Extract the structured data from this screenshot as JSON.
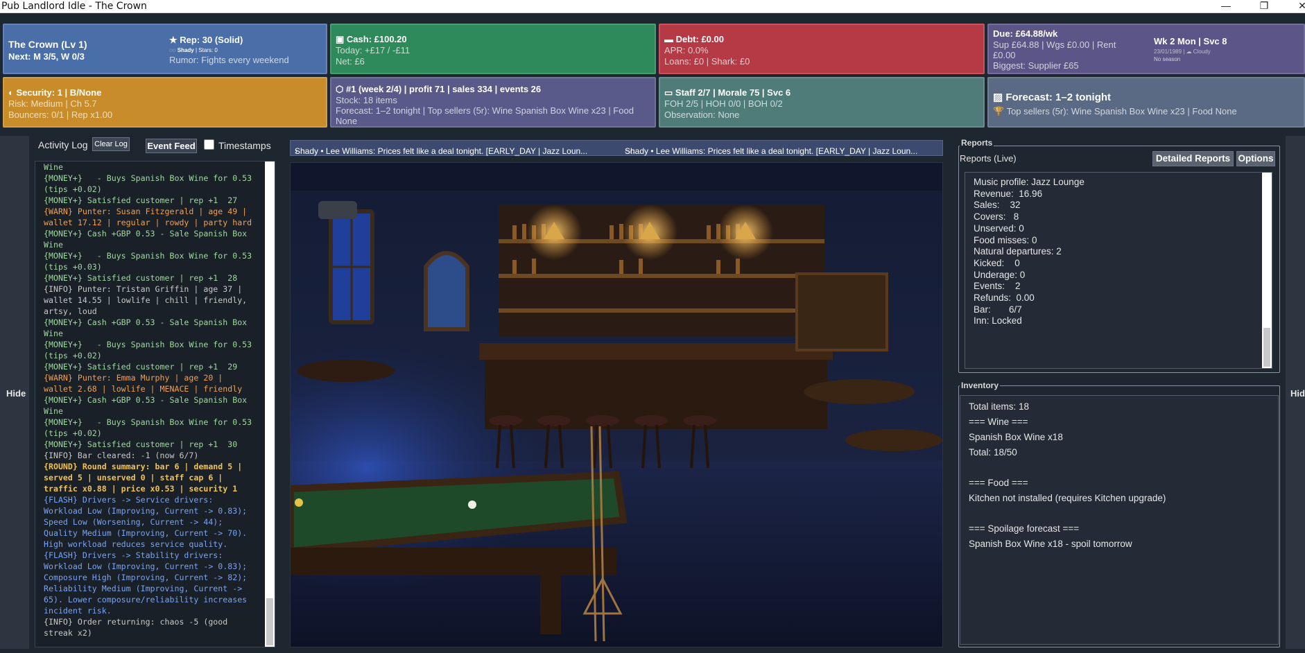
{
  "window": {
    "title": "Pub Landlord Idle - The Crown",
    "controls": {
      "minimize": "—",
      "maximize": "❐",
      "close": "✕"
    }
  },
  "panels": {
    "pub": {
      "name": "The Crown (Lv 1)",
      "next": "Next: M 3/5, W 0/3",
      "rep": "Rep: 30 (Solid)",
      "rep_sub_bold": "Shady",
      "rep_sub": " | Stars: 0",
      "rumor": "Rumor: Fights every weekend"
    },
    "cash": {
      "title": "Cash: £100.20",
      "today": "Today: +£17 / -£11",
      "net": "Net: £6"
    },
    "debt": {
      "title": "Debt: £0.00",
      "apr": "APR: 0.0%",
      "loans": "Loans: £0 | Shark: £0"
    },
    "due": {
      "title": "Due: £64.88/wk",
      "breakdown_1": "Sup £64.88 | Wgs £0.00 | Rent",
      "breakdown_2": "£0.00",
      "biggest": "Biggest: Supplier £65",
      "week": "Wk 2 Mon | Svc 8",
      "date_weather": "23/01/1989 | ☁ Cloudy",
      "season": "No season"
    },
    "security": {
      "title": "Security: 1 | B/None",
      "risk": "Risk: Medium | Ch 5.7",
      "bouncers": "Bouncers: 0/1 | Rep x1.00"
    },
    "ranking": {
      "title": "#1 (week 2/4) | profit 71 | sales 334 | events 26",
      "stock": "Stock: 18 items",
      "forecast_1": "Forecast: 1–2 tonight | Top sellers (5r): Wine Spanish Box Wine x23 | Food",
      "forecast_2": "None"
    },
    "staff": {
      "title": "Staff 2/7 | Morale 75 | Svc 6",
      "roles": "FOH 2/5 | HOH 0/0 | BOH 0/2",
      "observation": "Observation: None"
    },
    "forecast": {
      "title": "Forecast: 1–2 tonight",
      "top": "Top sellers (5r): Wine Spanish Box Wine x23 | Food None"
    }
  },
  "sides": {
    "left_hide": "Hide",
    "right_hide": "Hid"
  },
  "activity": {
    "label": "Activity Log",
    "clear": "Clear Log",
    "event_feed": "Event Feed",
    "timestamps": "Timestamps",
    "lines": [
      {
        "cls": "c-money",
        "text": "Wine"
      },
      {
        "cls": "c-money",
        "text": "{MONEY+}   - Buys Spanish Box Wine for 0.53"
      },
      {
        "cls": "c-money",
        "text": "(tips +0.02)"
      },
      {
        "cls": "c-money",
        "text": "{MONEY+} Satisfied customer | rep +1  27"
      },
      {
        "cls": "c-warn",
        "text": "{WARN} Punter: Susan Fitzgerald | age 49 |"
      },
      {
        "cls": "c-warn",
        "text": "wallet 17.12 | regular | rowdy | party hard"
      },
      {
        "cls": "c-money",
        "text": "{MONEY+} Cash +GBP 0.53 - Sale Spanish Box"
      },
      {
        "cls": "c-money",
        "text": "Wine"
      },
      {
        "cls": "c-money",
        "text": "{MONEY+}   - Buys Spanish Box Wine for 0.53"
      },
      {
        "cls": "c-money",
        "text": "(tips +0.03)"
      },
      {
        "cls": "c-money",
        "text": "{MONEY+} Satisfied customer | rep +1  28"
      },
      {
        "cls": "c-info",
        "text": "{INFO} Punter: Tristan Griffin | age 37 |"
      },
      {
        "cls": "c-info",
        "text": "wallet 14.55 | lowlife | chill | friendly,"
      },
      {
        "cls": "c-info",
        "text": "artsy, loud"
      },
      {
        "cls": "c-money",
        "text": "{MONEY+} Cash +GBP 0.53 - Sale Spanish Box"
      },
      {
        "cls": "c-money",
        "text": "Wine"
      },
      {
        "cls": "c-money",
        "text": "{MONEY+}   - Buys Spanish Box Wine for 0.53"
      },
      {
        "cls": "c-money",
        "text": "(tips +0.02)"
      },
      {
        "cls": "c-money",
        "text": "{MONEY+} Satisfied customer | rep +1  29"
      },
      {
        "cls": "c-warn",
        "text": "{WARN} Punter: Emma Murphy | age 20 |"
      },
      {
        "cls": "c-warn",
        "text": "wallet 2.68 | lowlife | MENACE | friendly"
      },
      {
        "cls": "c-money",
        "text": "{MONEY+} Cash +GBP 0.53 - Sale Spanish Box"
      },
      {
        "cls": "c-money",
        "text": "Wine"
      },
      {
        "cls": "c-money",
        "text": "{MONEY+}   - Buys Spanish Box Wine for 0.53"
      },
      {
        "cls": "c-money",
        "text": "(tips +0.02)"
      },
      {
        "cls": "c-money",
        "text": "{MONEY+} Satisfied customer | rep +1  30"
      },
      {
        "cls": "c-info",
        "text": "{INFO} Bar cleared: -1 (now 6/7)"
      },
      {
        "cls": "c-round",
        "text": "{ROUND} Round summary: bar 6 | demand 5 |"
      },
      {
        "cls": "c-round",
        "text": "served 5 | unserved 0 | staff cap 6 |"
      },
      {
        "cls": "c-round",
        "text": "traffic x0.88 | price x0.53 | security 1"
      },
      {
        "cls": "c-flash",
        "text": "{FLASH} Drivers -> Service drivers:"
      },
      {
        "cls": "c-flash",
        "text": "Workload Low (Improving, Current -> 0.83);"
      },
      {
        "cls": "c-flash",
        "text": "Speed Low (Worsening, Current -> 44);"
      },
      {
        "cls": "c-flash",
        "text": "Quality Medium (Improving, Current -> 70)."
      },
      {
        "cls": "c-flash",
        "text": "High workload reduces service quality."
      },
      {
        "cls": "c-flash",
        "text": "{FLASH} Drivers -> Stability drivers:"
      },
      {
        "cls": "c-flash",
        "text": "Workload Low (Improving, Current -> 0.83);"
      },
      {
        "cls": "c-flash",
        "text": "Composure High (Improving, Current -> 82);"
      },
      {
        "cls": "c-flash",
        "text": "Reliability Medium (Improving, Current ->"
      },
      {
        "cls": "c-flash",
        "text": "65). Lower composure/reliability increases"
      },
      {
        "cls": "c-flash",
        "text": "incident risk."
      },
      {
        "cls": "c-info",
        "text": "{INFO} Order returning: chaos -5 (good"
      },
      {
        "cls": "c-info",
        "text": "streak x2)"
      }
    ]
  },
  "ticker": {
    "item_1": "Shady • Lee Williams: Prices felt like a deal tonight. [EARLY_DAY | Jazz Loun...",
    "item_2": "Shady • Lee Williams: Prices felt like a deal tonight. [EARLY_DAY | Jazz Loun..."
  },
  "reports": {
    "group": "Reports",
    "live": "Reports (Live)",
    "detailed": "Detailed Reports",
    "options": "Options",
    "lines": [
      "Music profile: Jazz Lounge",
      "Revenue:  16.96",
      "Sales:    32",
      "Covers:   8",
      "Unserved: 0",
      "Food misses: 0",
      "Natural departures: 2",
      "Kicked:    0",
      "Underage: 0",
      "Events:    2",
      "Refunds:  0.00",
      "Bar:       6/7",
      "Inn: Locked"
    ]
  },
  "inventory": {
    "group": "Inventory",
    "lines": [
      "Total items: 18",
      "=== Wine ===",
      "Spanish Box Wine x18",
      "Total: 18/50",
      "",
      "=== Food ===",
      "Kitchen not installed (requires Kitchen upgrade)",
      "",
      "=== Spoilage forecast ===",
      "Spanish Box Wine x18 - spoil tomorrow"
    ]
  }
}
